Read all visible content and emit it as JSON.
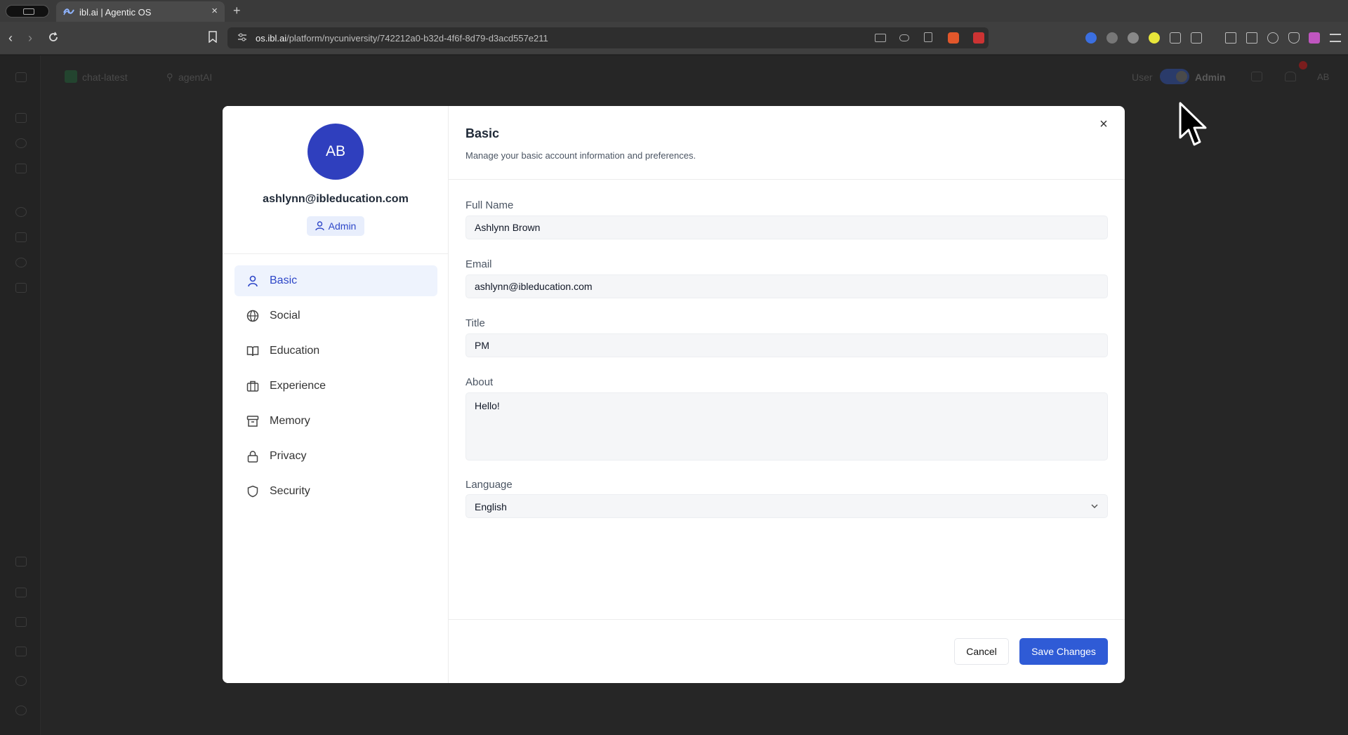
{
  "browser": {
    "tab_title": "ibl.ai | Agentic OS",
    "tab_close": "×",
    "new_tab": "+",
    "url_host": "os.ibl.ai",
    "url_path": "/platform/nycuniversity/742212a0-b32d-4f6f-8d79-d3acd557e211"
  },
  "app": {
    "model_selector": "chat-latest",
    "agent_selector": "agentAI",
    "mode_user": "User",
    "mode_admin": "Admin",
    "user_initials": "AB"
  },
  "profile": {
    "initials": "AB",
    "email": "ashlynn@ibleducation.com",
    "role": "Admin"
  },
  "nav": {
    "items": [
      {
        "label": "Basic",
        "icon": "user-icon"
      },
      {
        "label": "Social",
        "icon": "globe-icon"
      },
      {
        "label": "Education",
        "icon": "book-icon"
      },
      {
        "label": "Experience",
        "icon": "briefcase-icon"
      },
      {
        "label": "Memory",
        "icon": "archive-icon"
      },
      {
        "label": "Privacy",
        "icon": "lock-icon"
      },
      {
        "label": "Security",
        "icon": "shield-icon"
      }
    ],
    "active": "Basic"
  },
  "section": {
    "title": "Basic",
    "description": "Manage your basic account information and preferences."
  },
  "form": {
    "full_name_label": "Full Name",
    "full_name_value": "Ashlynn Brown",
    "email_label": "Email",
    "email_value": "ashlynn@ibleducation.com",
    "title_label": "Title",
    "title_value": "PM",
    "about_label": "About",
    "about_value": "Hello!",
    "language_label": "Language",
    "language_value": "English"
  },
  "buttons": {
    "cancel": "Cancel",
    "save": "Save Changes",
    "close": "×"
  },
  "colors": {
    "accent": "#2f5bd6",
    "avatar": "#2f3fbe",
    "active_nav_bg": "#eef3fd",
    "overlay": "#262626"
  }
}
